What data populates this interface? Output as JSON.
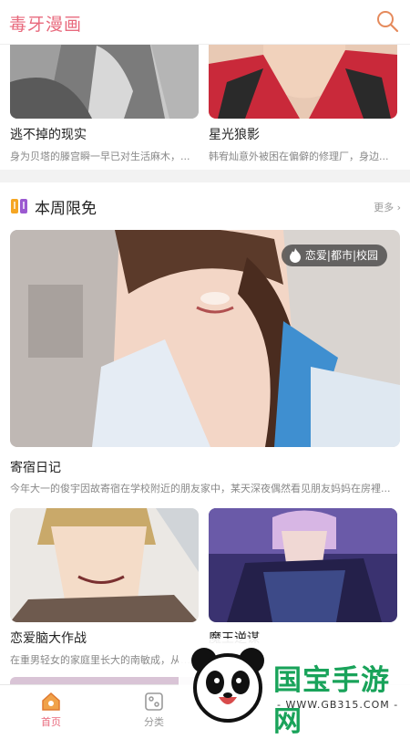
{
  "header": {
    "app_title": "毒牙漫画",
    "search_icon": "search-icon",
    "accent": "#e86a7d"
  },
  "top_row": [
    {
      "title": "逃不掉的现实",
      "desc": "身为贝塔的滕宫瞬一早已对生活麻木，..."
    },
    {
      "title": "星光狼影",
      "desc": "韩宥灿意外被困在偏僻的修理厂，身边..."
    }
  ],
  "weekly_free": {
    "section_title": "本周限免",
    "section_icon": "book-icon",
    "more_label": "更多",
    "featured": {
      "tag": "恋爱|都市|校园",
      "tag_icon": "flame-icon",
      "title": "寄宿日记",
      "desc": "今年大一的俊宇因故寄宿在学校附近的朋友家中，某天深夜偶然看见朋友妈妈在房裡..."
    },
    "cards": [
      {
        "title": "恋爱脑大作战",
        "desc": "在重男轻女的家庭里长大的南敏成，从小..."
      },
      {
        "title": "魔王逆谋",
        "desc": ""
      }
    ]
  },
  "tabbar": {
    "items": [
      {
        "label": "首页",
        "icon": "home-icon",
        "active": true
      },
      {
        "label": "分类",
        "icon": "category-icon",
        "active": false
      }
    ]
  },
  "watermark": {
    "text": "国宝手游网",
    "url": "- WWW.GB315.COM -"
  }
}
